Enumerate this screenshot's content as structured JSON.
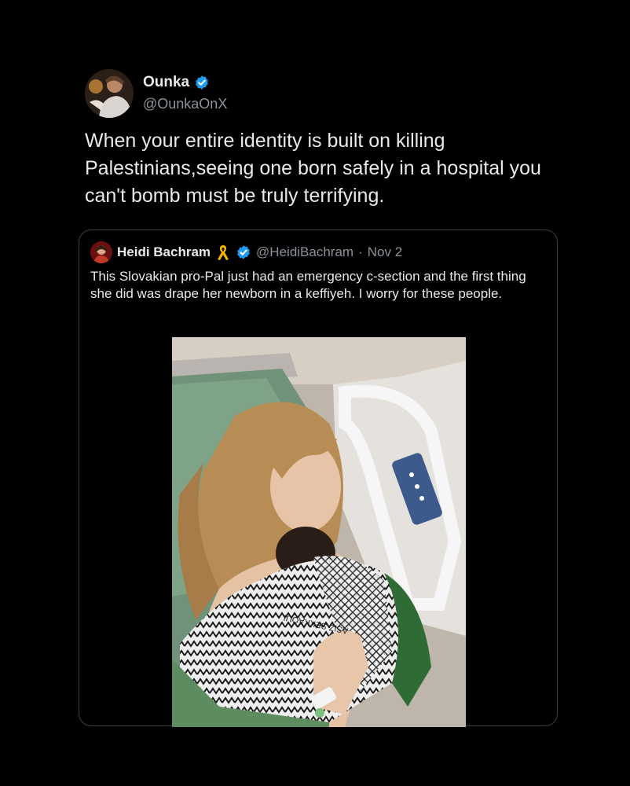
{
  "tweet": {
    "display_name": "Ounka",
    "handle": "@OunkaOnX",
    "text": "When your entire identity is built on killing Palestinians,seeing one born safely in a hospital you can't bomb must be truly terrifying."
  },
  "quoted": {
    "display_name": "Heidi Bachram",
    "handle": "@HeidiBachram",
    "separator": "·",
    "date": "Nov 2",
    "text": "This Slovakian pro-Pal just had an emergency c-section and the first thing she did was drape her newborn in a keffiyeh. I worry for these people.",
    "image_text": "ASIZ SEKKAOUI"
  },
  "colors": {
    "background": "#000000",
    "text": "#e7e9ea",
    "secondary_text": "#8b9299",
    "verified": "#1d9bf0",
    "border": "#3c4043"
  }
}
